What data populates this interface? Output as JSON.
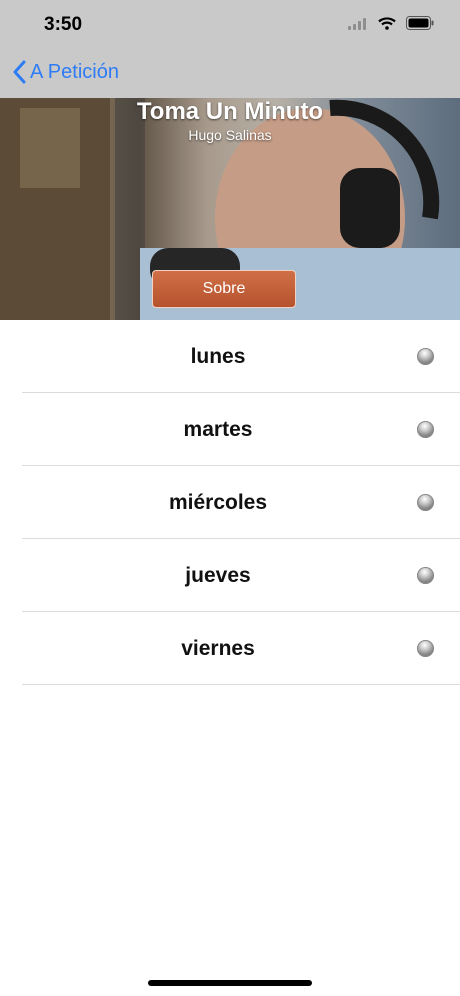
{
  "status_bar": {
    "time": "3:50"
  },
  "nav": {
    "back_label": "A Petición"
  },
  "hero": {
    "title": "Toma Un Minuto",
    "subtitle": "Hugo Salinas",
    "button_label": "Sobre"
  },
  "list": {
    "items": [
      {
        "label": "lunes"
      },
      {
        "label": "martes"
      },
      {
        "label": "miércoles"
      },
      {
        "label": "jueves"
      },
      {
        "label": "viernes"
      }
    ]
  },
  "icons": {
    "signal": "cellular-signal-icon",
    "wifi": "wifi-icon",
    "battery": "battery-icon",
    "back": "chevron-left-icon",
    "status_dot": "status-dot-icon"
  },
  "colors": {
    "accent": "#2d7cf6",
    "nav_bg": "#c9c9c9",
    "button": "#c3603a"
  }
}
